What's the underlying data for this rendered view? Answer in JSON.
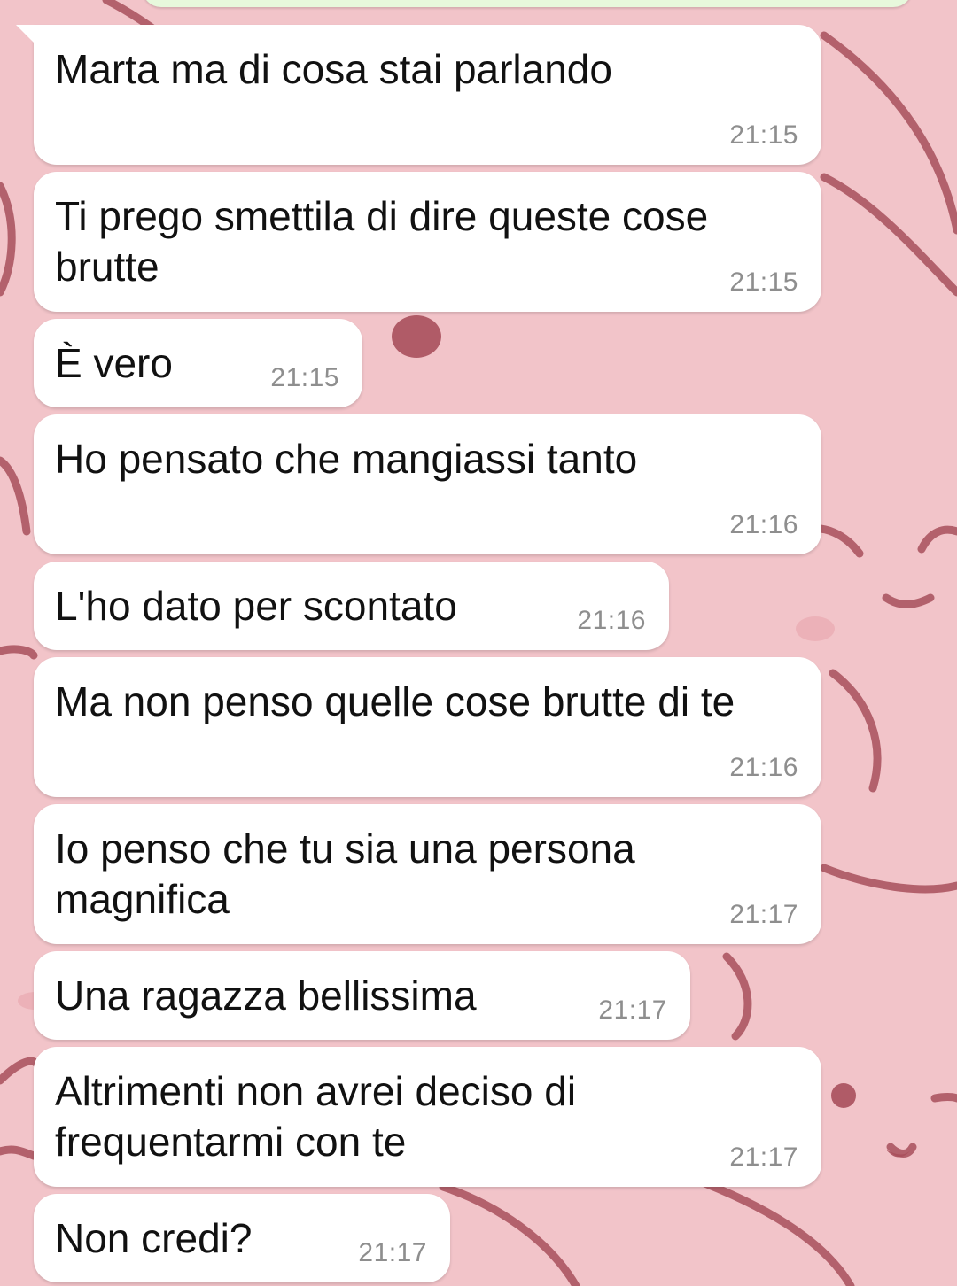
{
  "wallpaper": {
    "base_color": "#f2c4c9",
    "line_color": "#a8505c",
    "blob_color": "#e9a9b1"
  },
  "messages": [
    {
      "text": "Marta ma di cosa stai parlando",
      "time": "21:15"
    },
    {
      "text": "Ti prego smettila di dire queste cose brutte",
      "time": "21:15"
    },
    {
      "text": "È vero",
      "time": "21:15"
    },
    {
      "text": "Ho pensato che mangiassi tanto",
      "time": "21:16"
    },
    {
      "text": "L'ho dato per scontato",
      "time": "21:16"
    },
    {
      "text": "Ma non penso quelle cose brutte di te",
      "time": "21:16"
    },
    {
      "text": "Io penso che tu sia una persona magnifica",
      "time": "21:17"
    },
    {
      "text": "Una ragazza bellissima",
      "time": "21:17"
    },
    {
      "text": "Altrimenti non avrei deciso di frequentarmi con te",
      "time": "21:17"
    },
    {
      "text": "Non credi?",
      "time": "21:17"
    }
  ]
}
